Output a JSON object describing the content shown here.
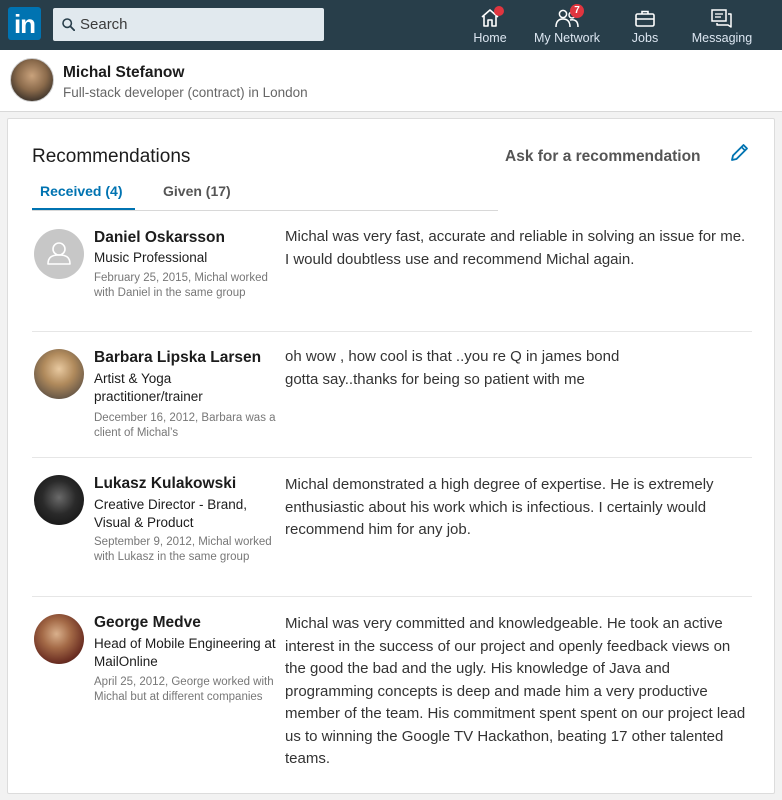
{
  "topbar": {
    "logo_text": "in",
    "search": {
      "placeholder": "Search"
    },
    "nav": [
      {
        "label": "Home",
        "icon": "home-icon",
        "badge": ""
      },
      {
        "label": "My Network",
        "icon": "network-icon",
        "badge": "7"
      },
      {
        "label": "Jobs",
        "icon": "briefcase-icon",
        "badge": ""
      },
      {
        "label": "Messaging",
        "icon": "messaging-icon",
        "badge": ""
      }
    ],
    "accent_color": "#0073b1",
    "bar_color": "#283e4a",
    "badge_color": "#e0353f"
  },
  "profile": {
    "name": "Michal Stefanow",
    "headline": "Full-stack developer (contract) in London"
  },
  "card": {
    "title": "Recommendations",
    "ask_link": "Ask for a recommendation",
    "tabs": [
      {
        "label": "Received (4)",
        "active": true
      },
      {
        "label": "Given (17)",
        "active": false
      }
    ]
  },
  "recommendations": [
    {
      "name": "Daniel Oskarsson",
      "role": "Music Professional",
      "meta": "February 25, 2015, Michal worked with Daniel in the same group",
      "text": "Michal was very fast, accurate and reliable in solving an issue for me. I would doubtless use and recommend Michal again."
    },
    {
      "name": "Barbara Lipska Larsen",
      "role": "Artist & Yoga practitioner/trainer",
      "meta": "December 16, 2012, Barbara was a client of Michal’s",
      "text": "oh wow , how cool is that ..you re Q in james bond\ngotta say..thanks for being so patient with me"
    },
    {
      "name": "Lukasz Kulakowski",
      "role": "Creative Director - Brand, Visual & Product",
      "meta": "September 9, 2012, Michal worked with Lukasz in the same group",
      "text": "Michal demonstrated a high degree of expertise. He is extremely enthusiastic about his work which is infectious. I certainly would recommend him for any job."
    },
    {
      "name": "George Medve",
      "role": "Head of Mobile Engineering at MailOnline",
      "meta": "April 25, 2012, George worked with Michal but at different companies",
      "text": "Michal was very committed and knowledgeable. He took an active interest in the success of our project and openly feedback views on the good the bad and the ugly. His knowledge of Java and programming concepts is deep and made him a very productive member of the team. His commitment spent spent on our project lead us to winning the Google TV Hackathon, beating 17 other talented teams."
    }
  ]
}
